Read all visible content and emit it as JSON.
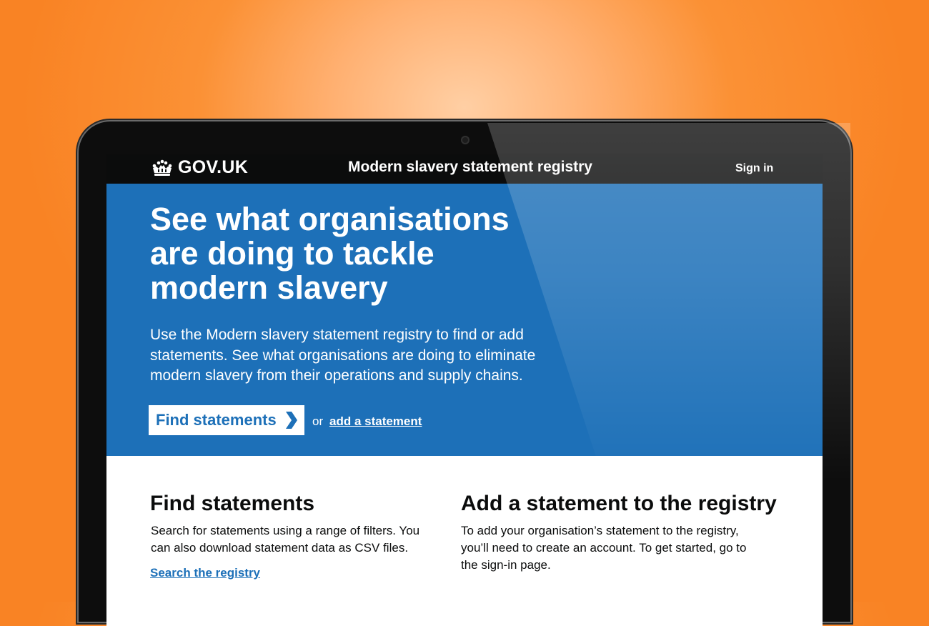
{
  "header": {
    "logo_text": "GOV.UK",
    "service_name": "Modern slavery statement registry",
    "sign_in_label": "Sign in"
  },
  "hero": {
    "title": "See what organisations are doing to tackle modern slavery",
    "description": "Use the Modern slavery statement registry to find or add statements. See what organisations are doing to eliminate modern slavery from their operations and supply chains.",
    "find_button_label": "Find statements",
    "or_text": "or",
    "add_link_label": "add a statement"
  },
  "find_section": {
    "heading": "Find statements",
    "text": "Search for statements using a range of filters. You can also download statement data as CSV files.",
    "link_label": "Search the registry"
  },
  "add_section": {
    "heading": "Add a statement to the registry",
    "text": "To add your organisation’s statement to the registry, you’ll need to create an account. To get started, go to the sign-in page."
  },
  "colors": {
    "brand_blue": "#1d70b8",
    "header_black": "#0b0c0c",
    "background_orange": "#f98324"
  },
  "icons": [
    "crown-icon",
    "chevron-right-icon",
    "camera-icon"
  ]
}
